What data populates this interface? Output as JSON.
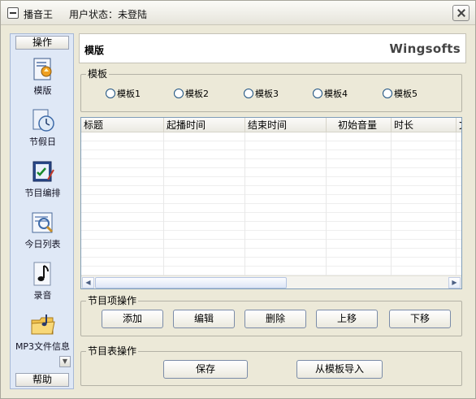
{
  "window": {
    "app_name": "播音王",
    "status_text": "用户状态：未登陆"
  },
  "nav": {
    "top_button": "操作",
    "bottom_button": "帮助",
    "items": [
      {
        "label": "模版",
        "icon": "template-icon"
      },
      {
        "label": "节假日",
        "icon": "holiday-clock-icon"
      },
      {
        "label": "节目编排",
        "icon": "schedule-edit-icon"
      },
      {
        "label": "今日列表",
        "icon": "today-list-icon"
      },
      {
        "label": "录音",
        "icon": "music-note-icon"
      },
      {
        "label": "MP3文件信息",
        "icon": "folder-music-icon"
      }
    ]
  },
  "header": {
    "title": "模版",
    "brand": "Wingsofts"
  },
  "template_group": {
    "title": "模板",
    "options": [
      "模板1",
      "模板2",
      "模板3",
      "模板4",
      "模板5"
    ]
  },
  "table": {
    "columns": [
      "标题",
      "起播时间",
      "结束时间",
      "初始音量",
      "时长",
      "文"
    ]
  },
  "item_ops": {
    "title": "节目项操作",
    "buttons": [
      "添加",
      "编辑",
      "删除",
      "上移",
      "下移"
    ]
  },
  "list_ops": {
    "title": "节目表操作",
    "buttons": [
      "保存",
      "从模板导入"
    ]
  }
}
